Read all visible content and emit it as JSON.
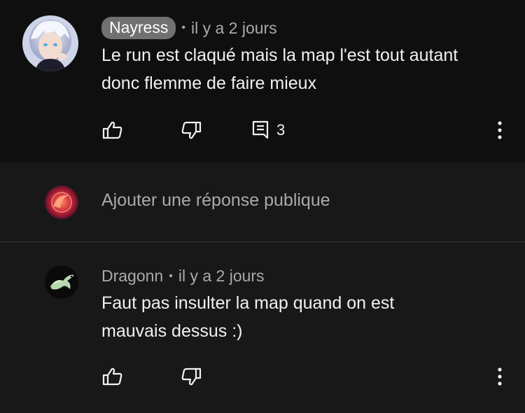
{
  "comment": {
    "author": "Nayress",
    "time": "il y a 2 jours",
    "text_line1": "Le run est claqué mais la map l'est tout autant",
    "text_line2": "donc flemme de faire mieux",
    "reply_count": "3"
  },
  "reply_box": {
    "placeholder": "Ajouter une réponse publique"
  },
  "reply": {
    "author": "Dragonn",
    "time": "il y a 2 jours",
    "text_line1": "Faut pas insulter la map quand on est",
    "text_line2": "mauvais dessus :)"
  },
  "icons": {
    "like": "thumb-up-icon",
    "dislike": "thumb-down-icon",
    "replies": "comment-icon",
    "more": "more-vert-icon"
  }
}
